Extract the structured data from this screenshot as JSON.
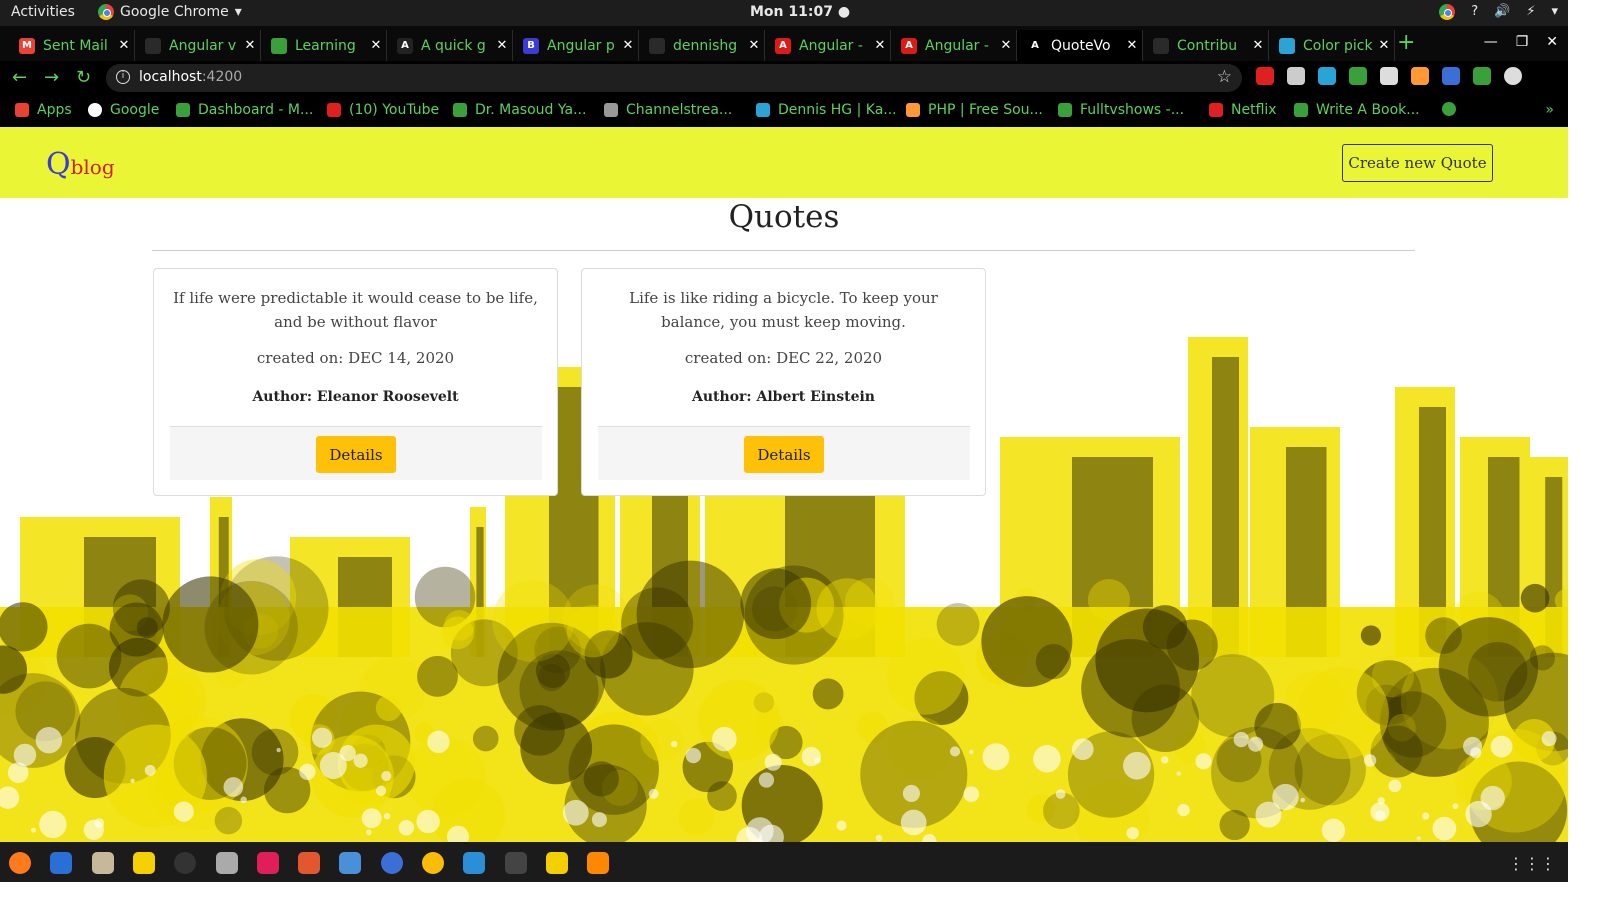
{
  "topbar": {
    "activities": "Activities",
    "app_name": "Google Chrome",
    "app_arrow": "▾",
    "clock": "Mon 11:07 ●",
    "tray": [
      "?",
      "🔊",
      "⚡",
      "▾"
    ]
  },
  "tabs": [
    {
      "label": "Sent Mail",
      "icon": "gmail-icon",
      "color": "#ea4335",
      "icon_text": "M"
    },
    {
      "label": "Angular v",
      "icon": "github-icon",
      "color": "#2a2a2a",
      "icon_text": ""
    },
    {
      "label": "Learning",
      "icon": "globe-icon",
      "color": "#3aa03a",
      "icon_text": ""
    },
    {
      "label": "A quick g",
      "icon": "angular-outline-icon",
      "color": "#222",
      "icon_text": "A"
    },
    {
      "label": "Angular p",
      "icon": "bootstrap-icon",
      "color": "#3b3bd6",
      "icon_text": "B"
    },
    {
      "label": "dennishg",
      "icon": "github-icon",
      "color": "#2a2a2a",
      "icon_text": ""
    },
    {
      "label": "Angular -",
      "icon": "angular-icon",
      "color": "#dd1b16",
      "icon_text": "A"
    },
    {
      "label": "Angular -",
      "icon": "angular-icon",
      "color": "#dd1b16",
      "icon_text": "A"
    },
    {
      "label": "QuoteVo",
      "icon": "angular-icon",
      "color": "#000",
      "icon_text": "A",
      "active": true
    },
    {
      "label": "Contribu",
      "icon": "github-icon",
      "color": "#2a2a2a",
      "icon_text": ""
    },
    {
      "label": "Color pick",
      "icon": "color-picker-icon",
      "color": "#2aa3d6",
      "icon_text": ""
    }
  ],
  "tab_close": "✕",
  "new_tab": "+",
  "window_controls": [
    "—",
    "❐",
    "✕"
  ],
  "address": {
    "host": "localhost",
    "port": ":4200",
    "info": "i",
    "star": "☆"
  },
  "nav": {
    "back": "←",
    "forward": "→",
    "reload": "↻"
  },
  "extension_colors": [
    "#e02020",
    "#cccccc",
    "#2aa3d6",
    "#3aa03a",
    "#dddddd",
    "#ff9933",
    "#3b6fd6",
    "#3aa03a",
    "#dddddd"
  ],
  "bookmarks": [
    {
      "label": "Apps",
      "icon": "apps-icon",
      "color": "#e94235"
    },
    {
      "label": "Google",
      "icon": "google-icon",
      "color": "#ffffff"
    },
    {
      "label": "Dashboard - M...",
      "icon": "moringa-icon",
      "color": "#3aa03a"
    },
    {
      "label": "(10) YouTube",
      "icon": "youtube-icon",
      "color": "#e02020"
    },
    {
      "label": "Dr. Masoud Ya...",
      "icon": "globe-icon",
      "color": "#3aa03a"
    },
    {
      "label": "Channelstrea...",
      "icon": "stream-icon",
      "color": "#999999"
    },
    {
      "label": "Dennis HG | Ka...",
      "icon": "kaggle-icon",
      "color": "#2aa3d6"
    },
    {
      "label": "PHP | Free Sou...",
      "icon": "php-icon",
      "color": "#ff9933"
    },
    {
      "label": "Fulltvshows -...",
      "icon": "globe-icon",
      "color": "#3aa03a"
    },
    {
      "label": "Netflix",
      "icon": "netflix-icon",
      "color": "#e02020"
    },
    {
      "label": "Write A Book...",
      "icon": "book-icon",
      "color": "#3aa03a"
    }
  ],
  "bookmarks_more": "»",
  "site": {
    "brand_q": "Q",
    "brand_rest": "blog",
    "create_button": "Create new Quote",
    "heading": "Quotes"
  },
  "quotes": [
    {
      "text": "If life were predictable it would cease to be life, and be without flavor",
      "created_label": "created on:",
      "created_date": "DEC 14, 2020",
      "author_label": "Author:",
      "author": "Eleanor Roosevelt",
      "details": "Details"
    },
    {
      "text": "Life is like riding a bicycle. To keep your balance, you must keep moving.",
      "created_label": "created on:",
      "created_date": "DEC 22, 2020",
      "author_label": "Author:",
      "author": "Albert Einstein",
      "details": "Details"
    }
  ],
  "colors": {
    "navbar": "#e9f535",
    "details_button": "#ffc107",
    "brand_q": "#3b3bd6",
    "brand_rest": "#d22020",
    "skyline_yellow": "#f2e000",
    "skyline_dark": "#3a3400"
  },
  "dock": [
    {
      "name": "firefox-icon",
      "color": "#ff7a1a"
    },
    {
      "name": "thunderbird-icon",
      "color": "#2a6fd6"
    },
    {
      "name": "files-icon",
      "color": "#c8b89a"
    },
    {
      "name": "rhythmbox-icon",
      "color": "#f5d000"
    },
    {
      "name": "obs-icon",
      "color": "#333333"
    },
    {
      "name": "camera-icon",
      "color": "#aaaaaa"
    },
    {
      "name": "slack-icon",
      "color": "#e01e5a"
    },
    {
      "name": "software-icon",
      "color": "#e2572e"
    },
    {
      "name": "document-icon",
      "color": "#4a90d9"
    },
    {
      "name": "help-icon",
      "color": "#3b6fd6"
    },
    {
      "name": "chrome-icon",
      "color": "#fbbc05"
    },
    {
      "name": "vscode-icon",
      "color": "#2a8fd6"
    },
    {
      "name": "terminal-icon",
      "color": "#444444"
    },
    {
      "name": "notes-icon",
      "color": "#f5d000"
    },
    {
      "name": "vlc-icon",
      "color": "#ff8800"
    }
  ],
  "apps_grid": "⋮⋮⋮"
}
